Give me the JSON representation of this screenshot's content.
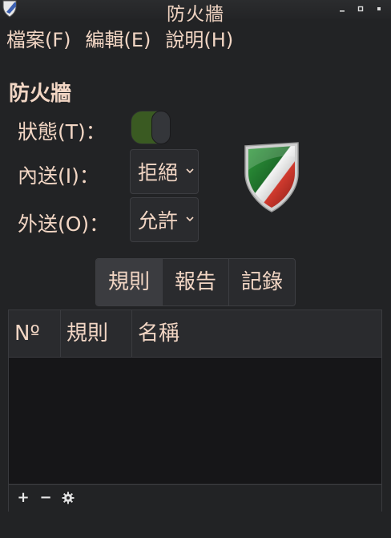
{
  "window": {
    "title": "防火牆",
    "min_icon": "minimize-icon",
    "max_icon": "maximize-icon",
    "close_icon": "close-icon"
  },
  "menu": {
    "file": "檔案(F)",
    "edit": "編輯(E)",
    "help": "說明(H)"
  },
  "firewall": {
    "heading": "防火牆",
    "status_label": "狀態(T)：",
    "status_on": true,
    "incoming_label": "內送(I)：",
    "incoming_value": "拒絕",
    "outgoing_label": "外送(O)：",
    "outgoing_value": "允許"
  },
  "tabs": {
    "rules": "規則",
    "report": "報告",
    "log": "記錄",
    "active": "rules"
  },
  "table": {
    "columns": [
      "Nº",
      "規則",
      "名稱"
    ],
    "rows": []
  },
  "footer": {
    "add_label": "+",
    "remove_label": "−",
    "settings_icon": "gear-icon"
  },
  "colors": {
    "text": "#f2d6c4",
    "toggle_on": "#3a5a22",
    "shield_green": "#2e8b3a",
    "shield_red": "#c0302a"
  }
}
